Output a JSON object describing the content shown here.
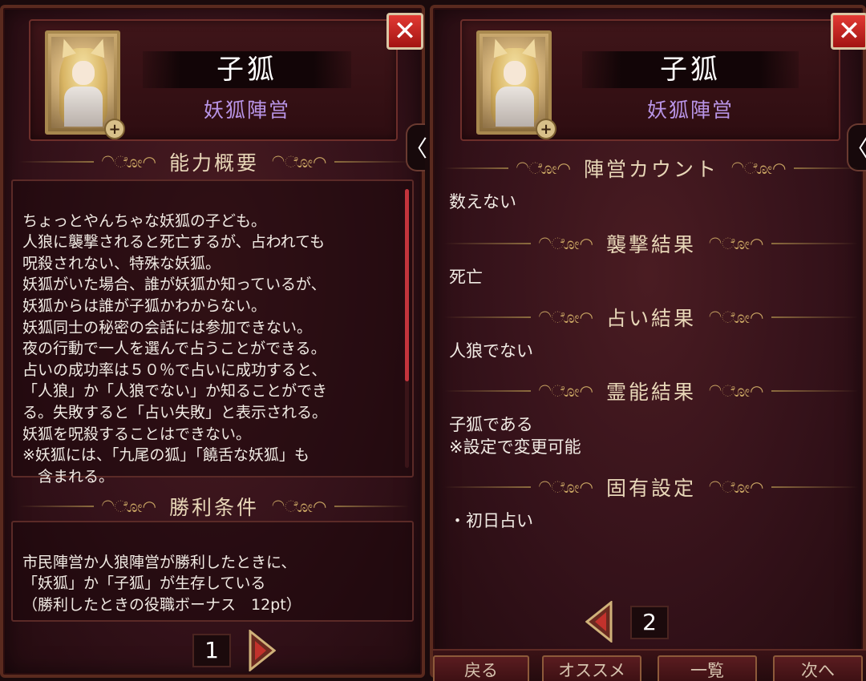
{
  "left": {
    "close_glyph": "✕",
    "name": "子狐",
    "faction": "妖狐陣営",
    "tab_glyph": "〈",
    "ability_title": "能力概要",
    "ability_text": "ちょっとやんちゃな妖狐の子ども。\n人狼に襲撃されると死亡するが、占われても\n呪殺されない、特殊な妖狐。\n妖狐がいた場合、誰が妖狐か知っているが、\n妖狐からは誰が子狐かわからない。\n妖狐同士の秘密の会話には参加できない。\n夜の行動で一人を選んで占うことができる。\n占いの成功率は５０％で占いに成功すると、\n「人狼」か「人狼でない」か知ることができ\nる。失敗すると「占い失敗」と表示される。\n妖狐を呪殺することはできない。\n※妖狐には、「九尾の狐」「饒舌な妖狐」も\n　含まれる。",
    "victory_title": "勝利条件",
    "victory_text": "市民陣営か人狼陣営が勝利したときに、\n「妖狐」か「子狐」が生存している\n（勝利したときの役職ボーナス　12pt）",
    "page_number": "1"
  },
  "right": {
    "close_glyph": "✕",
    "name": "子狐",
    "faction": "妖狐陣営",
    "tab_glyph": "〈",
    "sections": [
      {
        "title": "陣営カウント",
        "text": "数えない"
      },
      {
        "title": "襲撃結果",
        "text": "死亡"
      },
      {
        "title": "占い結果",
        "text": "人狼でない"
      },
      {
        "title": "霊能結果",
        "text": "子狐である\n※設定で変更可能"
      },
      {
        "title": "固有設定",
        "text": "・初日占い"
      }
    ],
    "page_number": "2",
    "bottom_buttons": [
      "戻る",
      "オススメ",
      "一覧",
      "次へ"
    ]
  },
  "ornament": "◠ೋ◠",
  "colors": {
    "accent_red": "#c3343c",
    "gold": "#c9a563",
    "faction_purple": "#b894e6"
  }
}
